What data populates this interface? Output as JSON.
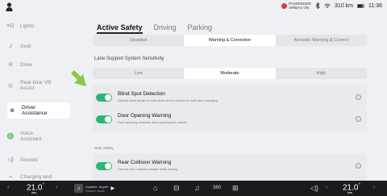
{
  "status": {
    "airbag_label": "PASSENGER AIRBAG ON",
    "range": "310 km",
    "time": "11:36",
    "icons": [
      "user-icon",
      "bluetooth-icon",
      "wifi-icon",
      "battery-icon"
    ]
  },
  "sidebar": {
    "items": [
      {
        "label": "Lights",
        "icon": "lights-icon"
      },
      {
        "label": "Seat",
        "icon": "seat-icon"
      },
      {
        "label": "Drive",
        "icon": "drive-icon"
      },
      {
        "label": "Real-time VR Assist",
        "icon": "vr-icon"
      },
      {
        "label": "Driver Assistance",
        "icon": "steering-icon",
        "active": true
      },
      {
        "label": "Voice Assistant",
        "icon": "voice-icon"
      },
      {
        "label": "Sounds",
        "icon": "sounds-icon"
      },
      {
        "label": "Charging and",
        "icon": "charging-icon"
      }
    ]
  },
  "main": {
    "tabs": [
      "Active Safety",
      "Driving",
      "Parking"
    ],
    "active_tab": "Active Safety",
    "warning_mode": {
      "options": [
        "Disabled",
        "Warning & Correction",
        "Acoustic Warning & Correct"
      ],
      "selected": "Warning & Correction"
    },
    "sensitivity": {
      "title": "Lane Support System Sensitivity",
      "options": [
        "Low",
        "Moderate",
        "High"
      ],
      "selected": "Moderate"
    },
    "rows": [
      {
        "title": "Blind Spot Detection",
        "desc": "Detects blind spots on both sides of the vehicle for safe lane changing",
        "on": true
      },
      {
        "title": "Door Opening Warning",
        "desc": "Door-opening reminder when parking the vehicle",
        "on": true
      }
    ],
    "rear_section_title": "Rear Safety",
    "rear_rows": [
      {
        "title": "Rear Collision Warning",
        "desc": "Detects rear collision danger while driving",
        "on": true
      }
    ],
    "accent": "#2bb673",
    "arrow_color": "#8cc63f"
  },
  "bottom": {
    "left_temp": "21.0",
    "right_temp": "21.0",
    "degree": "°",
    "media_title": "Anytime, Anywh",
    "media_sub": "Hosted mode",
    "icons": [
      "home-icon",
      "car-icon",
      "music-icon",
      "360-icon",
      "apps-icon",
      "volume-icon"
    ],
    "label_360": "360"
  }
}
